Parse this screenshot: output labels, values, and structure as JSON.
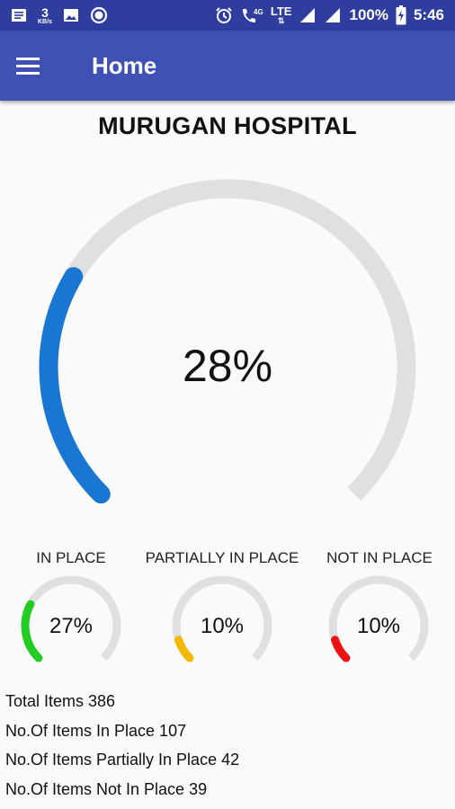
{
  "status_bar": {
    "speed_value": "3",
    "speed_unit": "KB/s",
    "network": "4G",
    "network2": "LTE",
    "battery": "100%",
    "time": "5:46"
  },
  "app_bar": {
    "title": "Home"
  },
  "hospital_name": "MURUGAN HOSPITAL",
  "overall": {
    "percent_text": "28%",
    "value": 0.28,
    "color": "#1976d2"
  },
  "gauges": [
    {
      "label": "IN PLACE",
      "percent_text": "27%",
      "value": 0.27,
      "color": "#22cc22"
    },
    {
      "label": "PARTIALLY IN PLACE",
      "percent_text": "10%",
      "value": 0.1,
      "color": "#f5b800"
    },
    {
      "label": "NOT IN PLACE",
      "percent_text": "10%",
      "value": 0.1,
      "color": "#ee1111"
    }
  ],
  "stats": [
    "Total Items 386",
    "No.Of Items In Place 107",
    "No.Of Items Partially In Place 42",
    "No.Of Items Not In Place 39"
  ],
  "track_color": "#e0e0e0"
}
